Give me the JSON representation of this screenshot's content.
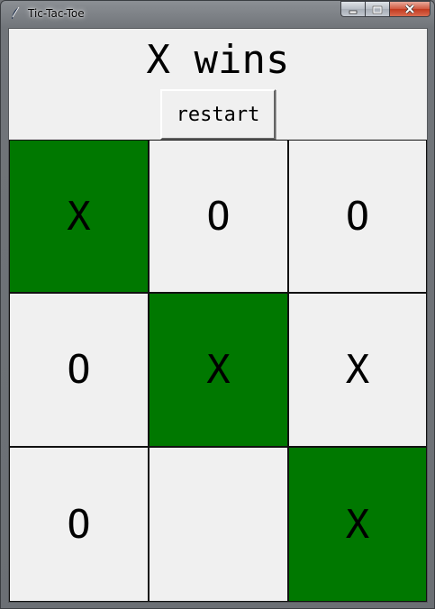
{
  "window": {
    "title": "Tic-Tac-Toe",
    "icon": "feather-icon"
  },
  "controls": {
    "minimize_icon": "minimize-icon",
    "maximize_icon": "maximize-icon",
    "close_icon": "close-icon"
  },
  "game": {
    "status": "X wins",
    "restart_label": "restart"
  },
  "board": {
    "cells": [
      {
        "value": "X",
        "highlight": true
      },
      {
        "value": "O",
        "highlight": false
      },
      {
        "value": "O",
        "highlight": false
      },
      {
        "value": "O",
        "highlight": false
      },
      {
        "value": "X",
        "highlight": true
      },
      {
        "value": "X",
        "highlight": false
      },
      {
        "value": "O",
        "highlight": false
      },
      {
        "value": "",
        "highlight": false
      },
      {
        "value": "X",
        "highlight": true
      }
    ]
  },
  "colors": {
    "win_highlight": "#007800",
    "cell_background": "#f0f0f0",
    "close_button": "#c23a1f"
  }
}
